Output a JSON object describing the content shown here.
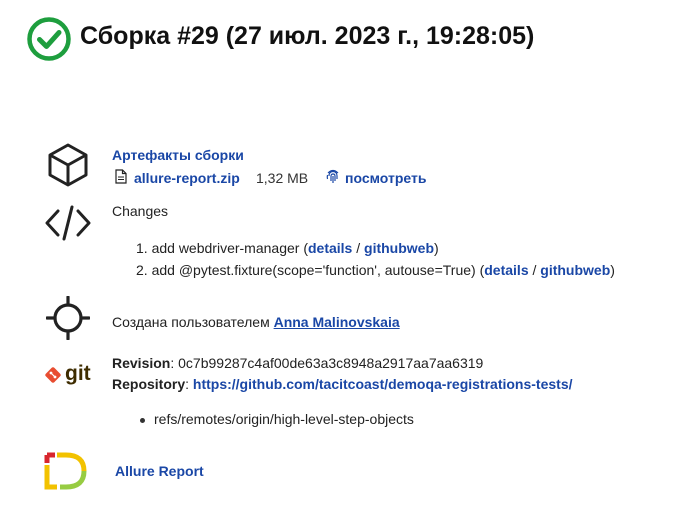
{
  "header": {
    "title": "Сборка #29 (27 июл. 2023 г., 19:28:05)",
    "status_icon": "check-circle-icon",
    "status_color": "#1e9e3e"
  },
  "artifacts": {
    "heading": "Артефакты сборки",
    "file_name": "allure-report.zip",
    "file_size": "1,32 MB",
    "view_label": "посмотреть"
  },
  "changes": {
    "heading": "Changes",
    "items": [
      {
        "num": "1.",
        "text": "add  webdriver-manager (",
        "details": "details",
        "sep": " / ",
        "githubweb": "githubweb",
        "close": ")"
      },
      {
        "num": "2.",
        "text": "add  @pytest.fixture(scope='function', autouse=True) (",
        "details": "details",
        "sep": " / ",
        "githubweb": "githubweb",
        "close": ")"
      }
    ]
  },
  "started_by": {
    "prefix": "Создана пользователем ",
    "user": "Anna Malinovskaia"
  },
  "git": {
    "logo_text": "git",
    "revision_label": "Revision",
    "revision_value": ": 0c7b99287c4af00de63a3c8948a2917aa7aa6319",
    "repository_label": "Repository",
    "repository_sep": ": ",
    "repository_url": "https://github.com/tacitcoast/demoqa-registrations-tests/",
    "branches": [
      "refs/remotes/origin/high-level-step-objects"
    ]
  },
  "allure": {
    "label": "Allure Report"
  }
}
